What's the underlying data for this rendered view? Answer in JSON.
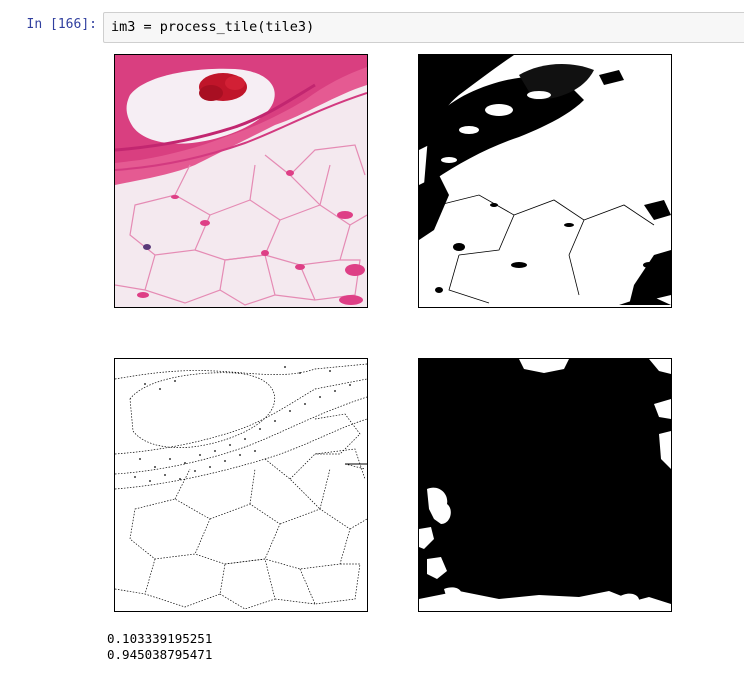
{
  "cell": {
    "prompt": "In [166]:",
    "code": "im3 = process_tile(tile3)"
  },
  "figure": {
    "panels": [
      {
        "name": "original-tile-image",
        "icon": "he-stained-tissue-image"
      },
      {
        "name": "thresholded-mask-image",
        "icon": "binary-mask-image"
      },
      {
        "name": "edge-detection-image",
        "icon": "edge-map-image"
      },
      {
        "name": "filled-mask-image",
        "icon": "filled-mask-image"
      }
    ]
  },
  "output": {
    "lines": [
      "0.103339195251",
      "0.945038795471"
    ]
  },
  "colors": {
    "prompt": "#303f9f",
    "input_bg": "#f7f7f7",
    "input_border": "#cfcfcf",
    "tissue_pink": "#e04a8a",
    "tissue_light": "#f3e6ee",
    "blood_red": "#c0152a"
  }
}
